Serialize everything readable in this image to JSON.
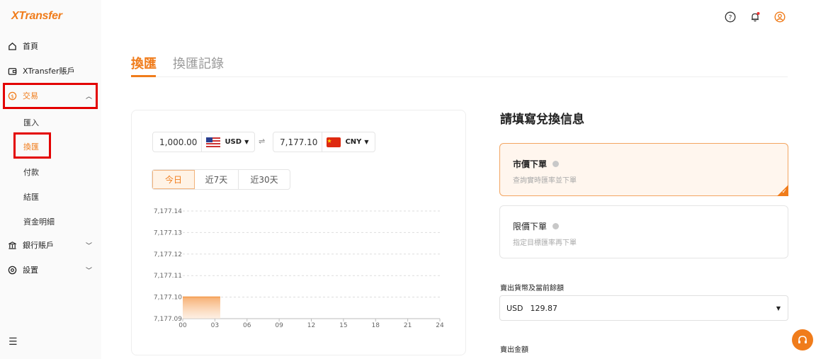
{
  "app": {
    "logo": "XTransfer"
  },
  "sidebar": {
    "items": [
      {
        "label": "首頁",
        "icon": "home-icon"
      },
      {
        "label": "XTransfer賬戶",
        "icon": "wallet-icon"
      },
      {
        "label": "交易",
        "icon": "dollar-coin-icon",
        "active": true,
        "expanded": true
      },
      {
        "label": "銀行賬戶",
        "icon": "bank-icon"
      },
      {
        "label": "設置",
        "icon": "settings-icon"
      }
    ],
    "trade_sub": [
      {
        "label": "匯入"
      },
      {
        "label": "換匯",
        "active": true
      },
      {
        "label": "付款"
      },
      {
        "label": "結匯"
      },
      {
        "label": "資金明細"
      }
    ]
  },
  "header": {
    "icons": [
      "help-icon",
      "bell-icon",
      "user-icon"
    ]
  },
  "tabs": [
    {
      "label": "換匯",
      "active": true
    },
    {
      "label": "換匯記錄",
      "active": false
    }
  ],
  "converter": {
    "sell_amount": "1,000.00",
    "sell_currency": "USD",
    "buy_amount": "7,177.10",
    "buy_currency": "CNY",
    "swap_symbol": "⇌"
  },
  "range_tabs": [
    "今日",
    "近7天",
    "近30天"
  ],
  "chart_data": {
    "type": "area",
    "x_ticks": [
      "00",
      "03",
      "06",
      "09",
      "12",
      "15",
      "18",
      "21",
      "24"
    ],
    "y_ticks": [
      "7,177.14",
      "7,177.13",
      "7,177.12",
      "7,177.11",
      "7,177.10",
      "7,177.09"
    ],
    "ylim": [
      7177.09,
      7177.14
    ],
    "xlim": [
      0,
      24
    ],
    "series": [
      {
        "x": [
          0,
          3.5
        ],
        "y": [
          7177.1,
          7177.1
        ]
      }
    ],
    "color": "#f5a25a",
    "grid": true
  },
  "order_form": {
    "title": "請填寫兌換信息",
    "options": [
      {
        "title": "市價下單",
        "desc": "查詢實時匯率並下單",
        "selected": true
      },
      {
        "title": "限價下單",
        "desc": "指定目標匯率再下單",
        "selected": false
      }
    ],
    "sell_label": "賣出貨幣及當前餘額",
    "sell_currency": "USD",
    "sell_balance": "129.87",
    "amount_label": "賣出金額"
  },
  "colors": {
    "accent": "#f07c1b",
    "highlight_box": "#e30000"
  }
}
